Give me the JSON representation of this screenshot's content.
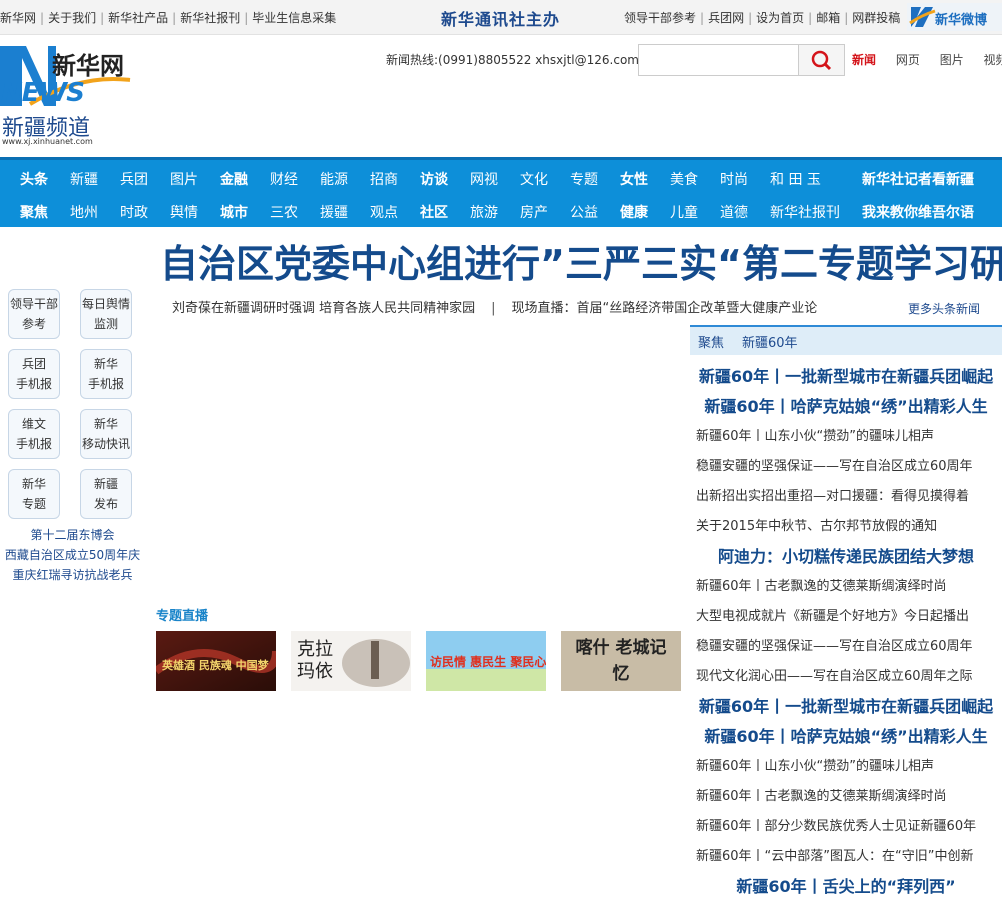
{
  "topbar": {
    "left_links": [
      "新华网",
      "关于我们",
      "新华社产品",
      "新华社报刊",
      "毕业生信息采集"
    ],
    "center_title": "新华通讯社主办",
    "right_links": [
      "领导干部参考",
      "兵团网",
      "设为首页",
      "邮箱",
      "网群投稿"
    ],
    "weibo_label": "新华微博"
  },
  "logo": {
    "brand_cn": "新华网",
    "brand_en": "NEWS",
    "channel": "新疆频道",
    "domain": "www.xj.xinhuanet.com"
  },
  "header": {
    "hotline": "新闻热线:(0991)8805522 xhsxjtl@126.com",
    "search_placeholder": "",
    "search_types": [
      "新闻",
      "网页",
      "图片",
      "视频"
    ]
  },
  "nav": {
    "row1": [
      {
        "label": "头条",
        "bold": true
      },
      {
        "label": "新疆"
      },
      {
        "label": "兵团"
      },
      {
        "label": "图片"
      },
      {
        "label": "金融",
        "bold": true
      },
      {
        "label": "财经"
      },
      {
        "label": "能源"
      },
      {
        "label": "招商"
      },
      {
        "label": "访谈",
        "bold": true
      },
      {
        "label": "网视"
      },
      {
        "label": "文化"
      },
      {
        "label": "专题"
      },
      {
        "label": "女性",
        "bold": true
      },
      {
        "label": "美食"
      },
      {
        "label": "时尚"
      },
      {
        "label": "和 田 玉"
      },
      {
        "label": "新华社记者看新疆",
        "bold": true
      }
    ],
    "row2": [
      {
        "label": "聚焦",
        "bold": true
      },
      {
        "label": "地州"
      },
      {
        "label": "时政"
      },
      {
        "label": "舆情"
      },
      {
        "label": "城市",
        "bold": true
      },
      {
        "label": "三农"
      },
      {
        "label": "援疆"
      },
      {
        "label": "观点"
      },
      {
        "label": "社区",
        "bold": true
      },
      {
        "label": "旅游"
      },
      {
        "label": "房产"
      },
      {
        "label": "公益"
      },
      {
        "label": "健康",
        "bold": true
      },
      {
        "label": "儿童"
      },
      {
        "label": "道德"
      },
      {
        "label": "新华社报刊"
      },
      {
        "label": "我来教你维吾尔语",
        "bold": true
      }
    ]
  },
  "headline": {
    "title": "自治区党委中心组进行”三严三实“第二专题学习研讨",
    "sub1": "刘奇葆在新疆调研时强调 培育各族人民共同精神家园",
    "sub2": "现场直播：首届“丝路经济带国企改革暨大健康产业论",
    "more": "更多头条新闻"
  },
  "quick_links": [
    [
      "领导干部",
      "参考"
    ],
    [
      "每日舆情",
      "监测"
    ],
    [
      "兵团",
      "手机报"
    ],
    [
      "新华",
      "手机报"
    ],
    [
      "维文",
      "手机报"
    ],
    [
      "新华",
      "移动快讯"
    ],
    [
      "新华",
      "专题"
    ],
    [
      "新疆",
      "发布"
    ]
  ],
  "left_links": [
    "第十二届东博会",
    "西藏自治区成立50周年庆",
    "重庆红瑞寻访抗战老兵"
  ],
  "special": {
    "title": "专题直播",
    "thumbs": [
      {
        "caption": "英雄酒 民族魂 中国梦"
      },
      {
        "caption": "克拉玛依"
      },
      {
        "caption": "访民情 惠民生 聚民心"
      },
      {
        "caption": "喀什 老城记忆"
      }
    ]
  },
  "focus": {
    "tab1": "聚焦",
    "tab2": "新疆60年",
    "items": [
      {
        "text": "新疆60年丨一批新型城市在新疆兵团崛起",
        "big": true
      },
      {
        "text": "新疆60年丨哈萨克姑娘“绣”出精彩人生",
        "big": true
      },
      {
        "text": "新疆60年丨山东小伙“攒劲”的疆味儿相声"
      },
      {
        "text": "稳疆安疆的坚强保证——写在自治区成立60周年"
      },
      {
        "text": "出新招出实招出重招—对口援疆：看得见摸得着"
      },
      {
        "text": "关于2015年中秋节、古尔邦节放假的通知"
      },
      {
        "text": "阿迪力：小切糕传递民族团结大梦想",
        "big": true
      },
      {
        "text": "新疆60年丨古老飘逸的艾德莱斯绸演绎时尚"
      },
      {
        "text": "大型电视成就片《新疆是个好地方》今日起播出"
      },
      {
        "text": "稳疆安疆的坚强保证——写在自治区成立60周年"
      },
      {
        "text": "现代文化润心田——写在自治区成立60周年之际"
      },
      {
        "text": "新疆60年丨一批新型城市在新疆兵团崛起",
        "big": true
      },
      {
        "text": "新疆60年丨哈萨克姑娘“绣”出精彩人生",
        "big": true
      },
      {
        "text": "新疆60年丨山东小伙“攒劲”的疆味儿相声"
      },
      {
        "text": "新疆60年丨古老飘逸的艾德莱斯绸演绎时尚"
      },
      {
        "text": "新疆60年丨部分少数民族优秀人士见证新疆60年"
      },
      {
        "text": "新疆60年丨“云中部落”图瓦人：在“守旧”中创新"
      },
      {
        "text": "新疆60年丨舌尖上的“拜列西”",
        "big": true
      }
    ]
  },
  "colors": {
    "nav_blue": "#0d8fd9",
    "headline_blue": "#144b8c",
    "accent_red": "#d4141a"
  }
}
